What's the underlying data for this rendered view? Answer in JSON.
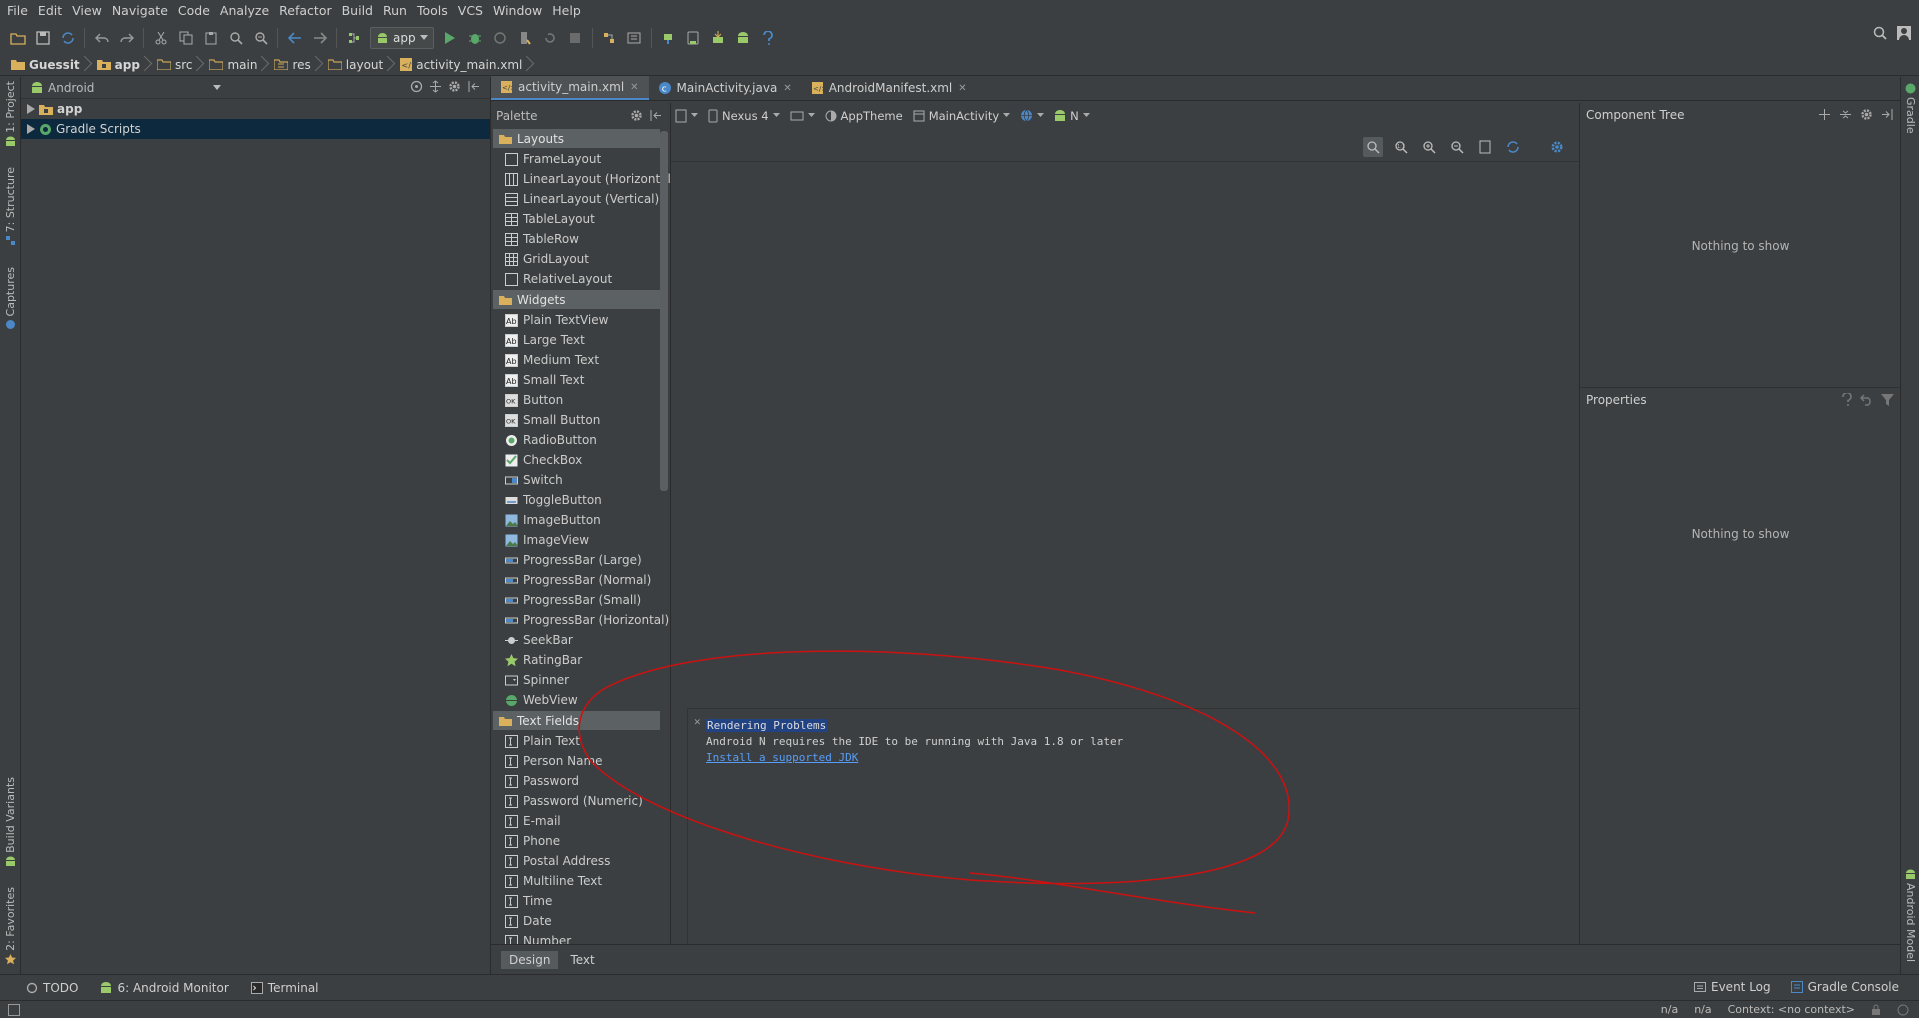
{
  "menu": [
    "File",
    "Edit",
    "View",
    "Navigate",
    "Code",
    "Analyze",
    "Refactor",
    "Build",
    "Run",
    "Tools",
    "VCS",
    "Window",
    "Help"
  ],
  "toolbar": {
    "run_config": "app"
  },
  "breadcrumbs": [
    "Guessit",
    "app",
    "src",
    "main",
    "res",
    "layout",
    "activity_main.xml"
  ],
  "left_tool_tabs": [
    "1: Project",
    "7: Structure",
    "Captures",
    "Build Variants",
    "2: Favorites"
  ],
  "project": {
    "view_mode": "Android",
    "tree": [
      {
        "label": "app"
      },
      {
        "label": "Gradle Scripts"
      }
    ]
  },
  "editor_tabs": [
    {
      "label": "activity_main.xml",
      "icon": "xml-file-icon"
    },
    {
      "label": "MainActivity.java",
      "icon": "class-icon"
    },
    {
      "label": "AndroidManifest.xml",
      "icon": "xml-file-icon"
    }
  ],
  "palette": {
    "title": "Palette",
    "groups": [
      {
        "name": "Layouts",
        "items": [
          "FrameLayout",
          "LinearLayout (Horizontal)",
          "LinearLayout (Vertical)",
          "TableLayout",
          "TableRow",
          "GridLayout",
          "RelativeLayout"
        ]
      },
      {
        "name": "Widgets",
        "items": [
          "Plain TextView",
          "Large Text",
          "Medium Text",
          "Small Text",
          "Button",
          "Small Button",
          "RadioButton",
          "CheckBox",
          "Switch",
          "ToggleButton",
          "ImageButton",
          "ImageView",
          "ProgressBar (Large)",
          "ProgressBar (Normal)",
          "ProgressBar (Small)",
          "ProgressBar (Horizontal)",
          "SeekBar",
          "RatingBar",
          "Spinner",
          "WebView"
        ]
      },
      {
        "name": "Text Fields",
        "items": [
          "Plain Text",
          "Person Name",
          "Password",
          "Password (Numeric)",
          "E-mail",
          "Phone",
          "Postal Address",
          "Multiline Text",
          "Time",
          "Date",
          "Number"
        ]
      }
    ]
  },
  "design_toolbar": {
    "device": "Nexus 4",
    "theme": "AppTheme",
    "activity": "MainActivity",
    "api": "N"
  },
  "rendering": {
    "title": "Rendering Problems",
    "message": "Android N requires the IDE to be running with Java 1.8 or later",
    "link": "Install a supported JDK"
  },
  "component_tree": {
    "title": "Component Tree",
    "empty": "Nothing to show"
  },
  "properties": {
    "title": "Properties",
    "empty": "Nothing to show"
  },
  "right_tool_tabs": [
    "Gradle",
    "Android Model"
  ],
  "design_tabs": [
    "Design",
    "Text"
  ],
  "bottom_tools": {
    "todo": "TODO",
    "android_monitor": "6: Android Monitor",
    "terminal": "Terminal",
    "event_log": "Event Log",
    "gradle_console": "Gradle Console"
  },
  "status": {
    "pos1": "n/a",
    "pos2": "n/a",
    "context": "Context: <no context>"
  },
  "colors": {
    "accent": "#4a88c7",
    "link": "#589df6",
    "annotation": "#cc1111"
  }
}
